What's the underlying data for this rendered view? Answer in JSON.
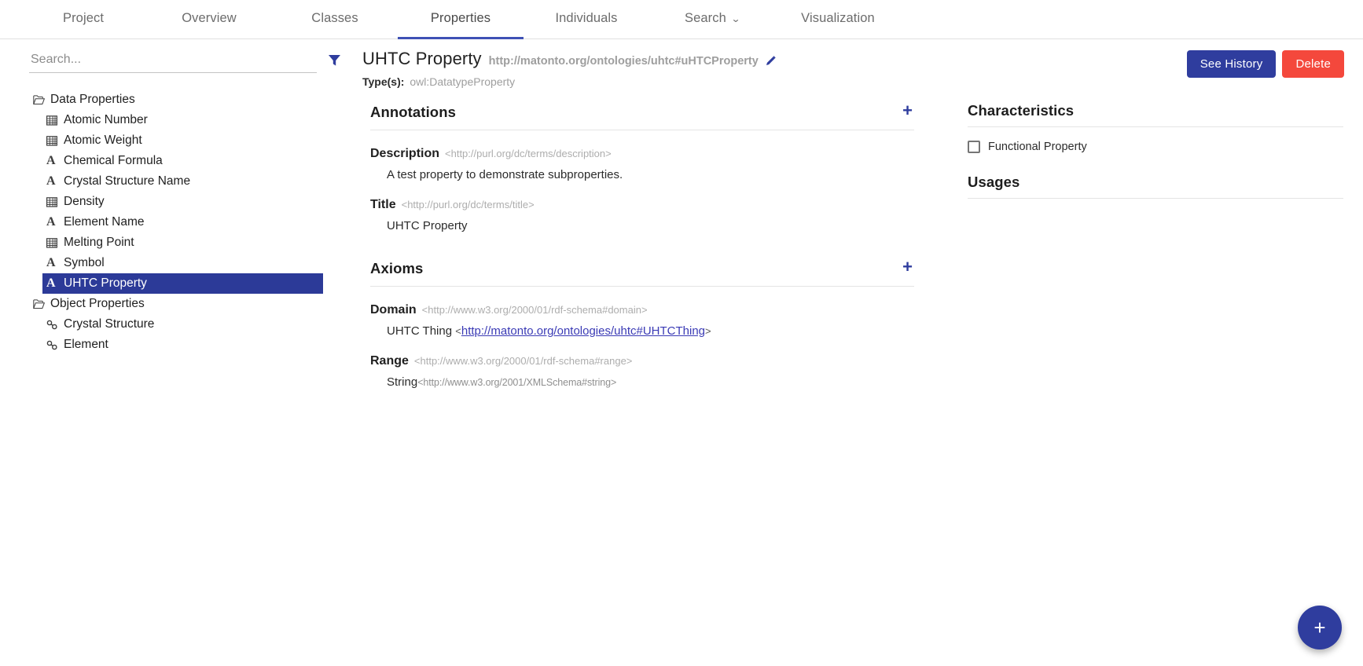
{
  "nav": {
    "tabs": [
      {
        "label": "Project",
        "active": false,
        "caret": false
      },
      {
        "label": "Overview",
        "active": false,
        "caret": false
      },
      {
        "label": "Classes",
        "active": false,
        "caret": false
      },
      {
        "label": "Properties",
        "active": true,
        "caret": false
      },
      {
        "label": "Individuals",
        "active": false,
        "caret": false
      },
      {
        "label": "Search",
        "active": false,
        "caret": true
      },
      {
        "label": "Visualization",
        "active": false,
        "caret": false
      }
    ],
    "caret_glyph": "⌄"
  },
  "sidebar": {
    "search": {
      "value": "",
      "placeholder": "Search..."
    },
    "filter_icon": "filter-icon",
    "tree": [
      {
        "label": "Data Properties",
        "type": "folder",
        "icon": "open-folder-icon",
        "selected": false
      },
      {
        "label": "Atomic Number",
        "type": "leaf",
        "icon": "numeric-datatype-icon",
        "selected": false
      },
      {
        "label": "Atomic Weight",
        "type": "leaf",
        "icon": "numeric-datatype-icon",
        "selected": false
      },
      {
        "label": "Chemical Formula",
        "type": "leaf",
        "icon": "string-datatype-icon",
        "selected": false
      },
      {
        "label": "Crystal Structure Name",
        "type": "leaf",
        "icon": "string-datatype-icon",
        "selected": false
      },
      {
        "label": "Density",
        "type": "leaf",
        "icon": "numeric-datatype-icon",
        "selected": false
      },
      {
        "label": "Element Name",
        "type": "leaf",
        "icon": "string-datatype-icon",
        "selected": false
      },
      {
        "label": "Melting Point",
        "type": "leaf",
        "icon": "numeric-datatype-icon",
        "selected": false
      },
      {
        "label": "Symbol",
        "type": "leaf",
        "icon": "string-datatype-icon",
        "selected": false
      },
      {
        "label": "UHTC Property",
        "type": "leaf",
        "icon": "string-datatype-icon",
        "selected": true
      },
      {
        "label": "Object Properties",
        "type": "folder",
        "icon": "open-folder-icon",
        "selected": false
      },
      {
        "label": "Crystal Structure",
        "type": "leaf",
        "icon": "link-icon",
        "selected": false
      },
      {
        "label": "Element",
        "type": "leaf",
        "icon": "link-icon",
        "selected": false
      }
    ]
  },
  "entity": {
    "title": "UHTC Property",
    "iri": "http://matonto.org/ontologies/uhtc#uHTCProperty",
    "edit_icon": "pencil-icon",
    "types_label": "Type(s):",
    "types_value": "owl:DatatypeProperty",
    "see_history_label": "See History",
    "delete_label": "Delete"
  },
  "annotations": {
    "title": "Annotations",
    "add_label": "+",
    "items": [
      {
        "name": "Description",
        "uri": "<http://purl.org/dc/terms/description>",
        "value": "A test property to demonstrate subproperties."
      },
      {
        "name": "Title",
        "uri": "<http://purl.org/dc/terms/title>",
        "value": "UHTC Property"
      }
    ]
  },
  "axioms": {
    "title": "Axioms",
    "add_label": "+",
    "items": [
      {
        "name": "Domain",
        "uri": "<http://www.w3.org/2000/01/rdf-schema#domain>",
        "value_label": "UHTC Thing",
        "value_link": "http://matonto.org/ontologies/uhtc#UHTCThing",
        "open_angle": "<",
        "close_angle": ">"
      },
      {
        "name": "Range",
        "uri": "<http://www.w3.org/2000/01/rdf-schema#range>",
        "value_label": "String",
        "value_uri": "<http://www.w3.org/2001/XMLSchema#string>"
      }
    ]
  },
  "characteristics": {
    "title": "Characteristics",
    "items": [
      {
        "label": "Functional Property",
        "checked": false
      }
    ]
  },
  "usages": {
    "title": "Usages"
  },
  "fab": {
    "label": "+",
    "icon": "plus-icon"
  },
  "colors": {
    "accent": "#2f3d9e",
    "danger": "#f4483c",
    "selection": "#2c3a98",
    "muted": "#9e9e9e"
  }
}
